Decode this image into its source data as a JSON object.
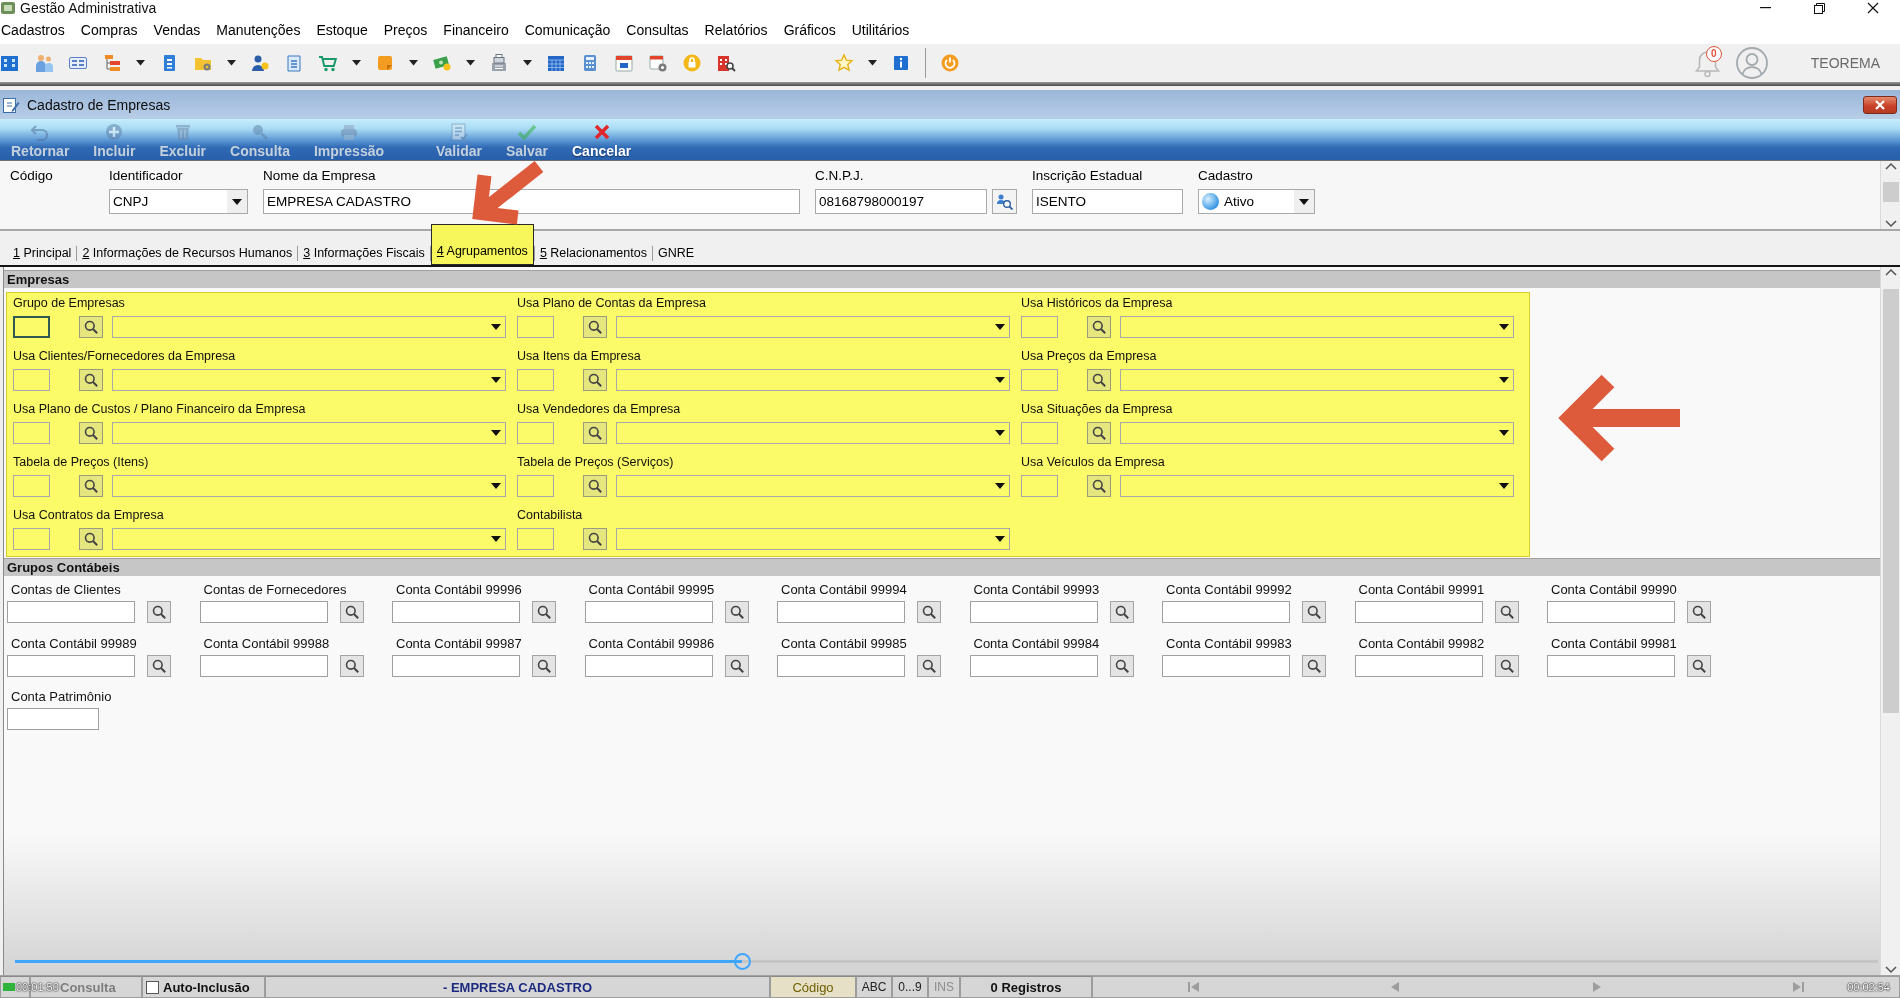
{
  "window": {
    "title": "Gestão Administrativa"
  },
  "menu": [
    "Cadastros",
    "Compras",
    "Vendas",
    "Manutenções",
    "Estoque",
    "Preços",
    "Financeiro",
    "Comunicação",
    "Consultas",
    "Relatórios",
    "Gráficos",
    "Utilitários"
  ],
  "toolbar_right": {
    "notifications": "0",
    "user": "TEOREMA"
  },
  "child_window": {
    "title": "Cadastro de Empresas"
  },
  "form_toolbar": {
    "groups": [
      {
        "buttons": [
          {
            "label": "Retornar",
            "disabled": true
          },
          {
            "label": "Incluir",
            "disabled": true
          },
          {
            "label": "Excluir",
            "disabled": true
          },
          {
            "label": "Consulta",
            "disabled": true
          },
          {
            "label": "Impressão",
            "disabled": true
          }
        ]
      },
      {
        "buttons": [
          {
            "label": "Validar",
            "disabled": true
          },
          {
            "label": "Salvar",
            "disabled": true
          },
          {
            "label": "Cancelar",
            "disabled": false
          }
        ]
      }
    ]
  },
  "header_fields": [
    {
      "kind": "label",
      "label": "Código"
    },
    {
      "kind": "select",
      "label": "Identificador",
      "value": "CNPJ"
    },
    {
      "kind": "text",
      "label": "Nome da Empresa",
      "value": "EMPRESA CADASTRO"
    },
    {
      "kind": "lookup",
      "label": "C.N.P.J.",
      "value": "08168798000197"
    },
    {
      "kind": "text",
      "label": "Inscrição Estadual",
      "value": "ISENTO"
    },
    {
      "kind": "status_select",
      "label": "Cadastro",
      "value": "Ativo"
    }
  ],
  "tabs": [
    {
      "key": "1",
      "label": "Principal",
      "selected": false
    },
    {
      "key": "2",
      "label": "Informações de Recursos Humanos",
      "selected": false
    },
    {
      "key": "3",
      "label": "Informações Fiscais",
      "selected": false
    },
    {
      "key": "4",
      "label": "Agrupamentos",
      "selected": true
    },
    {
      "key": "5",
      "label": "Relacionamentos",
      "selected": false
    },
    {
      "label": "GNRE",
      "selected": false
    }
  ],
  "sections": [
    {
      "kind": "combos",
      "title": "Empresas",
      "highlighted": true,
      "fields": [
        {
          "label": "Grupo de Empresas",
          "focused": true
        },
        {
          "label": "Usa Plano de Contas da Empresa",
          "focused": false
        },
        {
          "label": "Usa Históricos da Empresa",
          "focused": false
        },
        {
          "label": "Usa Clientes/Fornecedores da Empresa",
          "focused": false
        },
        {
          "label": "Usa Itens da Empresa",
          "focused": false
        },
        {
          "label": "Usa Preços da Empresa",
          "focused": false
        },
        {
          "label": "Usa Plano de Custos / Plano Financeiro da Empresa",
          "focused": false
        },
        {
          "label": "Usa Vendedores da Empresa",
          "focused": false
        },
        {
          "label": "Usa Situações da Empresa",
          "focused": false
        },
        {
          "label": "Tabela de Preços (Itens)",
          "focused": false
        },
        {
          "label": "Tabela de Preços (Serviços)",
          "focused": false
        },
        {
          "label": "Usa Veículos da Empresa",
          "focused": false
        },
        {
          "label": "Usa Contratos da Empresa",
          "focused": false
        },
        {
          "label": "Contabilista",
          "focused": false
        }
      ]
    },
    {
      "kind": "accounts",
      "title": "Grupos Contábeis",
      "highlighted": false,
      "fields": [
        {
          "label": "Contas de Clientes",
          "kind": "lookup"
        },
        {
          "label": "Contas de Fornecedores",
          "kind": "lookup"
        },
        {
          "label": "Conta Contábil 99996",
          "kind": "lookup"
        },
        {
          "label": "Conta Contábil 99995",
          "kind": "lookup"
        },
        {
          "label": "Conta Contábil 99994",
          "kind": "lookup"
        },
        {
          "label": "Conta Contábil 99993",
          "kind": "lookup"
        },
        {
          "label": "Conta Contábil 99992",
          "kind": "lookup"
        },
        {
          "label": "Conta Contábil 99991",
          "kind": "lookup"
        },
        {
          "label": "Conta Contábil 99990",
          "kind": "lookup"
        },
        {
          "label": "Conta Contábil 99989",
          "kind": "lookup"
        },
        {
          "label": "Conta Contábil 99988",
          "kind": "lookup"
        },
        {
          "label": "Conta Contábil 99987",
          "kind": "lookup"
        },
        {
          "label": "Conta Contábil 99986",
          "kind": "lookup"
        },
        {
          "label": "Conta Contábil 99985",
          "kind": "lookup"
        },
        {
          "label": "Conta Contábil 99984",
          "kind": "lookup"
        },
        {
          "label": "Conta Contábil 99983",
          "kind": "lookup"
        },
        {
          "label": "Conta Contábil 99982",
          "kind": "lookup"
        },
        {
          "label": "Conta Contábil 99981",
          "kind": "lookup"
        },
        {
          "label": "Conta Patrimônio",
          "kind": "plain"
        }
      ]
    }
  ],
  "annotations": [
    {
      "kind": "arrow-down-left"
    },
    {
      "kind": "arrow-left"
    }
  ],
  "status_bar": {
    "mode": {
      "label": "Consulta",
      "disabled": true
    },
    "auto_inclusion": {
      "label": "Auto-Inclusão",
      "checked": false
    },
    "record": "- EMPRESA CADASTRO",
    "search_key": "Código",
    "indicators": [
      {
        "label": "ABC",
        "disabled": false
      },
      {
        "label": "0...9",
        "disabled": false
      },
      {
        "label": "INS",
        "disabled": true
      }
    ],
    "count": "0 Registros",
    "navigation": [
      {
        "kind": "first",
        "disabled": true
      },
      {
        "kind": "previous",
        "disabled": true
      },
      {
        "kind": "next",
        "disabled": true
      },
      {
        "kind": "last",
        "disabled": true
      }
    ]
  },
  "video_player": {
    "elapsed": "00:01:50",
    "duration": "00:02:54",
    "level": 0.39
  }
}
